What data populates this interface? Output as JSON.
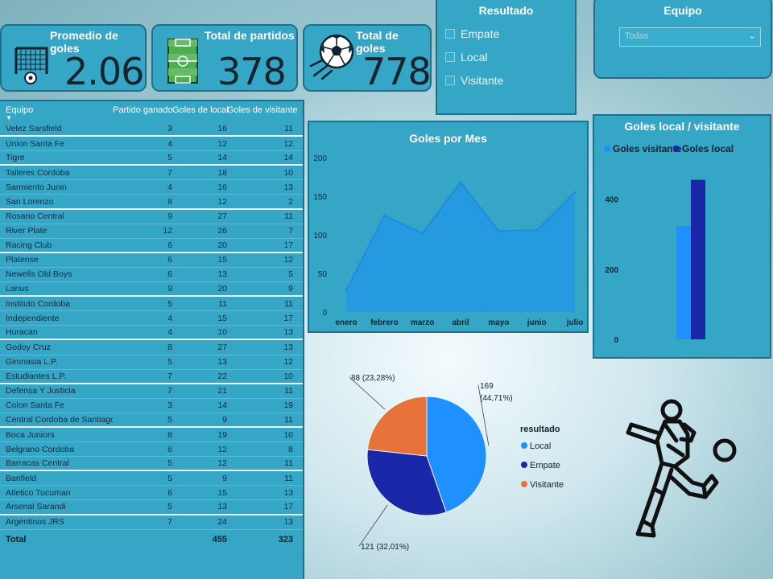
{
  "kpis": [
    {
      "title": "Promedio de goles",
      "value": "2.06",
      "icon": "soccer-goal-icon"
    },
    {
      "title": "Total de partidos",
      "value": "378",
      "icon": "soccer-field-icon"
    },
    {
      "title": "Total de goles",
      "value": "778",
      "icon": "soccer-ball-icon"
    }
  ],
  "resultado_slicer": {
    "title": "Resultado",
    "options": [
      "Empate",
      "Local",
      "Visitante"
    ]
  },
  "equipo_slicer": {
    "title": "Equipo",
    "selected": "Todas"
  },
  "table": {
    "headers": [
      "Equipo",
      "Partido ganado",
      "Goles de local",
      "Goles de visitante"
    ],
    "rows": [
      [
        "Velez Sarsfield",
        "3",
        "16",
        "11"
      ],
      [
        "Union Santa Fe",
        "4",
        "12",
        "12"
      ],
      [
        "Tigre",
        "5",
        "14",
        "14"
      ],
      [
        "Talleres Cordoba",
        "7",
        "18",
        "10"
      ],
      [
        "Sarmiento Junin",
        "4",
        "16",
        "13"
      ],
      [
        "San Lorenzo",
        "8",
        "12",
        "2"
      ],
      [
        "Rosario Central",
        "9",
        "27",
        "11"
      ],
      [
        "River Plate",
        "12",
        "26",
        "7"
      ],
      [
        "Racing Club",
        "6",
        "20",
        "17"
      ],
      [
        "Platense",
        "6",
        "15",
        "12"
      ],
      [
        "Newells Old Boys",
        "6",
        "13",
        "5"
      ],
      [
        "Lanus",
        "9",
        "20",
        "9"
      ],
      [
        "Instituto Cordoba",
        "5",
        "11",
        "11"
      ],
      [
        "Independiente",
        "4",
        "15",
        "17"
      ],
      [
        "Huracan",
        "4",
        "10",
        "13"
      ],
      [
        "Godoy Cruz",
        "8",
        "27",
        "13"
      ],
      [
        "Gimnasia L.P.",
        "5",
        "13",
        "12"
      ],
      [
        "Estudiantes L.P.",
        "7",
        "22",
        "10"
      ],
      [
        "Defensa Y Justicia",
        "7",
        "21",
        "11"
      ],
      [
        "Colon Santa Fe",
        "3",
        "14",
        "19"
      ],
      [
        "Central Cordoba de Santiago",
        "5",
        "9",
        "11"
      ],
      [
        "Boca Juniors",
        "8",
        "19",
        "10"
      ],
      [
        "Belgrano Cordoba",
        "6",
        "12",
        "8"
      ],
      [
        "Barracas Central",
        "5",
        "12",
        "11"
      ],
      [
        "Banfield",
        "5",
        "9",
        "11"
      ],
      [
        "Atletico Tucuman",
        "6",
        "15",
        "13"
      ],
      [
        "Arsenal Sarandi",
        "5",
        "13",
        "17"
      ],
      [
        "Argentinos JRS",
        "7",
        "24",
        "13"
      ]
    ],
    "total": [
      "Total",
      "",
      "455",
      "323"
    ]
  },
  "chart_data": [
    {
      "type": "area",
      "title": "Goles por Mes",
      "categories": [
        "enero",
        "febrero",
        "marzo",
        "abril",
        "mayo",
        "junio",
        "julio"
      ],
      "values": [
        28,
        125,
        102,
        168,
        105,
        106,
        155
      ],
      "ylim": [
        0,
        200
      ],
      "yticks": [
        "0",
        "50",
        "100",
        "150",
        "200"
      ],
      "color": "#2196e8"
    },
    {
      "type": "bar",
      "title": "Goles local / visitante",
      "series": [
        {
          "name": "Goles visitante",
          "values": [
            323
          ],
          "color": "#1e90ff"
        },
        {
          "name": "Goles local",
          "values": [
            455
          ],
          "color": "#1a27a8"
        }
      ],
      "ylim": [
        0,
        500
      ],
      "yticks": [
        "0",
        "200",
        "400"
      ],
      "legend": "top-left"
    },
    {
      "type": "pie",
      "legend_title": "resultado",
      "slices": [
        {
          "name": "Local",
          "value": 169,
          "label": "169 (44,71%)",
          "color": "#1e90ff"
        },
        {
          "name": "Empate",
          "value": 121,
          "label": "121 (32,01%)",
          "color": "#1a27a8"
        },
        {
          "name": "Visitante",
          "value": 88,
          "label": "88 (23,28%)",
          "color": "#e8733a"
        }
      ]
    }
  ]
}
